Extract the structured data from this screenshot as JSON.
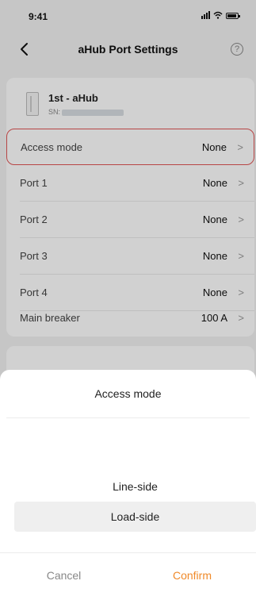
{
  "status_bar": {
    "time": "9:41"
  },
  "nav": {
    "title": "aHub Port Settings",
    "help_icon": "?"
  },
  "hub": {
    "name": "1st - aHub",
    "sn_label": "SN:"
  },
  "settings": [
    {
      "label": "Access mode",
      "value": "None",
      "selected": true
    },
    {
      "label": "Port 1",
      "value": "None"
    },
    {
      "label": "Port 2",
      "value": "None"
    },
    {
      "label": "Port 3",
      "value": "None"
    },
    {
      "label": "Port 4",
      "value": "None"
    },
    {
      "label": "Main breaker",
      "value": "100 A"
    }
  ],
  "chevron": ">",
  "picker": {
    "title": "Access mode",
    "options": [
      "Line-side",
      "Load-side"
    ],
    "selected_option": "Load-side",
    "cancel_label": "Cancel",
    "confirm_label": "Confirm"
  },
  "colors": {
    "accent": "#f08a2a",
    "selected_border": "#e05555"
  }
}
